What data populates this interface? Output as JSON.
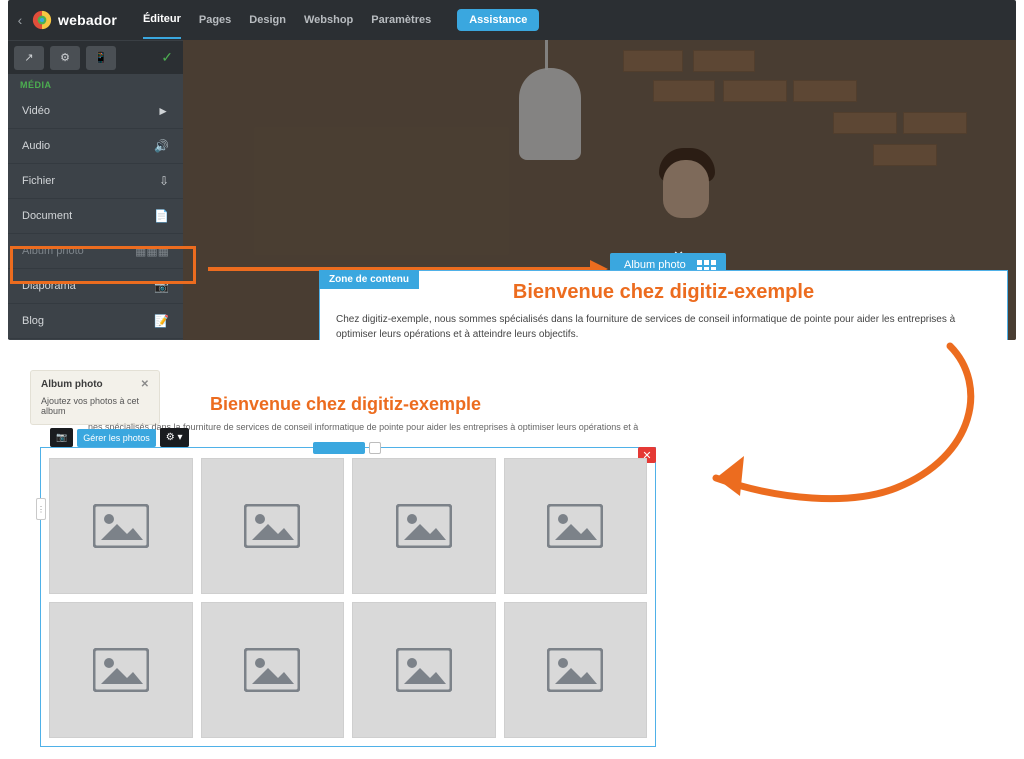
{
  "brand": "webador",
  "nav": {
    "items": [
      "Éditeur",
      "Pages",
      "Design",
      "Webshop",
      "Paramètres"
    ],
    "assist": "Assistance"
  },
  "sidebar": {
    "heading": "MÉDIA",
    "items": [
      {
        "label": "Vidéo",
        "icon": "video-icon"
      },
      {
        "label": "Audio",
        "icon": "speaker-icon"
      },
      {
        "label": "Fichier",
        "icon": "download-icon"
      },
      {
        "label": "Document",
        "icon": "document-icon"
      },
      {
        "label": "Album photo",
        "icon": "grid-icon"
      },
      {
        "label": "Diaporama",
        "icon": "slideshow-icon"
      },
      {
        "label": "Blog",
        "icon": "blog-icon"
      }
    ]
  },
  "drop_badge": "Album photo",
  "zone": {
    "tag": "Zone de contenu",
    "title": "Bienvenue chez digitiz-exemple",
    "body": "Chez digitiz-exemple, nous sommes spécialisés dans la fourniture de services de conseil informatique de pointe pour aider les entreprises à optimiser leurs opérations et à atteindre leurs objectifs."
  },
  "tooltip": {
    "title": "Album photo",
    "body": "Ajoutez vos photos à cet album"
  },
  "manage": {
    "button": "Gérer les photos"
  },
  "bottom": {
    "title": "Bienvenue chez digitiz-exemple",
    "desc": "nes spécialisés dans la fourniture de services de conseil informatique de pointe pour aider les entreprises à optimiser leurs opérations et à"
  },
  "colors": {
    "accent_blue": "#3aa7df",
    "accent_orange": "#ec6c1f",
    "sidebar_bg": "#3c4248"
  }
}
